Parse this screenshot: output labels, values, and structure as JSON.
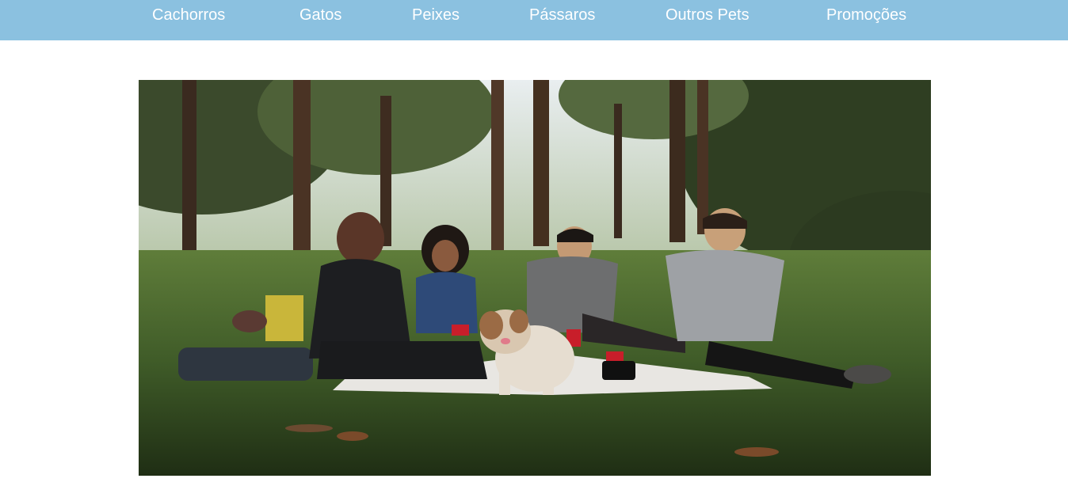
{
  "nav": {
    "items": [
      {
        "label": "Cachorros"
      },
      {
        "label": "Gatos"
      },
      {
        "label": "Peixes"
      },
      {
        "label": "Pássaros"
      },
      {
        "label": "Outros Pets"
      },
      {
        "label": "Promoções"
      }
    ]
  },
  "hero": {
    "icon": "group-picnic-photo"
  },
  "colors": {
    "nav_background": "#8bc1e0",
    "nav_text": "#ffffff",
    "page_background": "#ffffff"
  }
}
